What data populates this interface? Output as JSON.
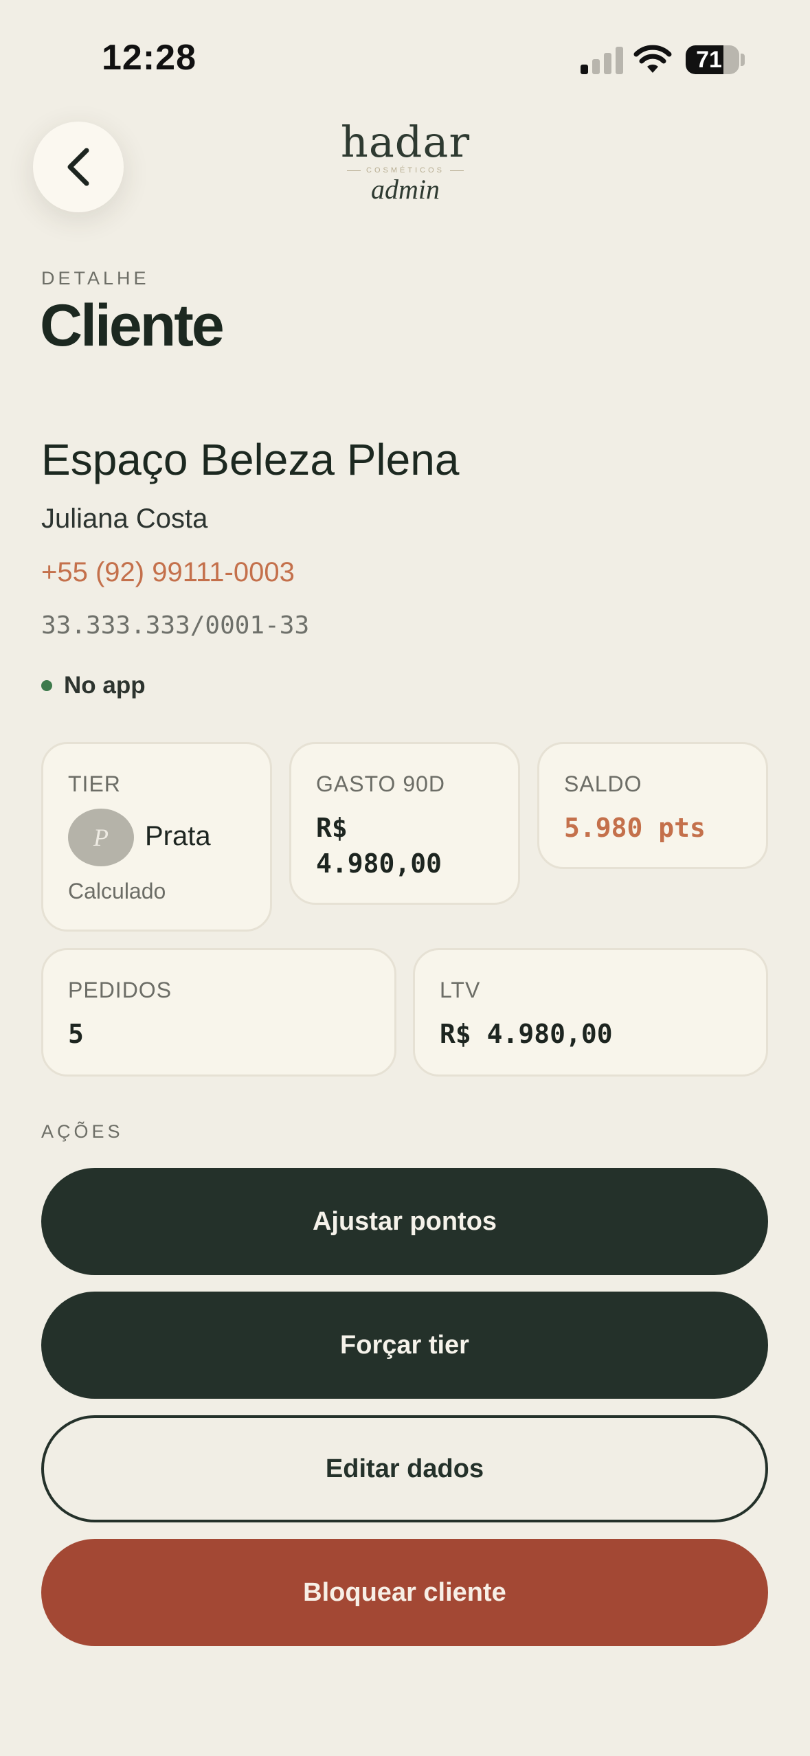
{
  "status_bar": {
    "time": "12:28",
    "battery_percent": "71",
    "battery_level": 0.71
  },
  "header": {
    "logo_word": "hadar",
    "logo_subtitle": "COSMÉTICOS",
    "logo_admin": "admin"
  },
  "page": {
    "eyebrow": "DETALHE",
    "title": "Cliente"
  },
  "client": {
    "business_name": "Espaço Beleza Plena",
    "contact_name": "Juliana Costa",
    "phone": "+55 (92) 99111-0003",
    "document": "33.333.333/0001-33",
    "app_status": "No app"
  },
  "stats": {
    "tier": {
      "label": "TIER",
      "avatar_letter": "P",
      "value": "Prata",
      "sub": "Calculado"
    },
    "spend_90d": {
      "label": "GASTO 90D",
      "value_line1": "R$",
      "value_line2": "4.980,00"
    },
    "balance": {
      "label": "SALDO",
      "value": "5.980 pts"
    },
    "orders": {
      "label": "PEDIDOS",
      "value": "5"
    },
    "ltv": {
      "label": "LTV",
      "value": "R$ 4.980,00"
    }
  },
  "actions": {
    "section_label": "AÇÕES",
    "adjust_points": "Ajustar pontos",
    "force_tier": "Forçar tier",
    "edit_data": "Editar dados",
    "block_client": "Bloquear cliente"
  },
  "colors": {
    "background": "#f1eee5",
    "primary_dark": "#24312a",
    "accent_terracotta": "#c4704b",
    "danger": "#a34834",
    "status_green": "#3e7a4c"
  }
}
